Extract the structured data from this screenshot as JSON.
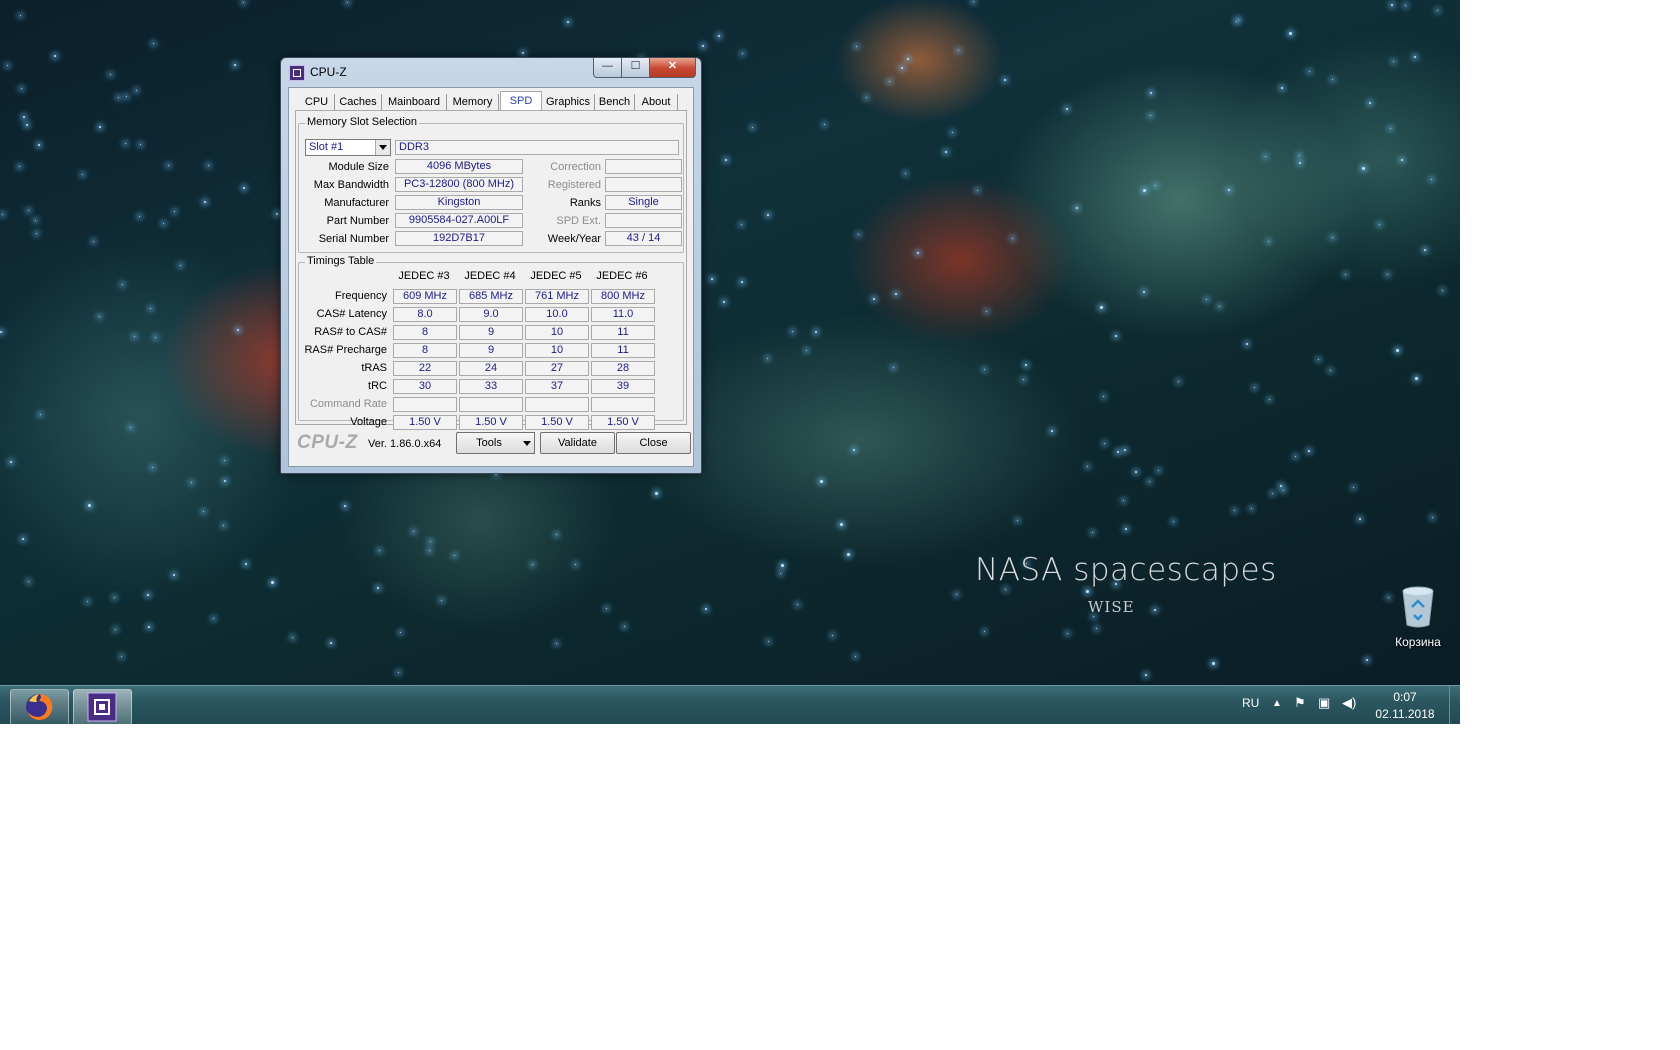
{
  "desktop": {
    "wallpaper_title": "NASA spacescapes",
    "wallpaper_subtitle": "WISE",
    "recycle_bin_label": "Корзина"
  },
  "taskbar": {
    "apps": [
      "firefox-icon",
      "cpu-z-icon"
    ],
    "language": "RU",
    "tray_icons": [
      "show-hidden-icons-arrow",
      "action-center-flag-icon",
      "network-icon",
      "volume-icon"
    ],
    "time": "0:07",
    "date": "02.11.2018"
  },
  "window": {
    "title": "CPU-Z",
    "controls": {
      "minimize": "—",
      "maximize": "☐",
      "close": "✕"
    },
    "tabs": [
      "CPU",
      "Caches",
      "Mainboard",
      "Memory",
      "SPD",
      "Graphics",
      "Bench",
      "About"
    ],
    "active_tab": "SPD"
  },
  "spd": {
    "slot_group_title": "Memory Slot Selection",
    "slot": "Slot #1",
    "memory_type": "DDR3",
    "labels": {
      "module_size": "Module Size",
      "max_bandwidth": "Max Bandwidth",
      "manufacturer": "Manufacturer",
      "part_number": "Part Number",
      "serial_number": "Serial Number",
      "correction": "Correction",
      "registered": "Registered",
      "ranks": "Ranks",
      "spd_ext": "SPD Ext.",
      "week_year": "Week/Year"
    },
    "values": {
      "module_size": "4096 MBytes",
      "max_bandwidth": "PC3-12800 (800 MHz)",
      "manufacturer": "Kingston",
      "part_number": "9905584-027.A00LF",
      "serial_number": "192D7B17",
      "correction": "",
      "registered": "",
      "ranks": "Single",
      "spd_ext": "",
      "week_year": "43 / 14"
    }
  },
  "timings": {
    "group_title": "Timings Table",
    "columns": [
      "JEDEC #3",
      "JEDEC #4",
      "JEDEC #5",
      "JEDEC #6"
    ],
    "rows": [
      {
        "label": "Frequency",
        "values": [
          "609 MHz",
          "685 MHz",
          "761 MHz",
          "800 MHz"
        ]
      },
      {
        "label": "CAS# Latency",
        "values": [
          "8.0",
          "9.0",
          "10.0",
          "11.0"
        ]
      },
      {
        "label": "RAS# to CAS#",
        "values": [
          "8",
          "9",
          "10",
          "11"
        ]
      },
      {
        "label": "RAS# Precharge",
        "values": [
          "8",
          "9",
          "10",
          "11"
        ]
      },
      {
        "label": "tRAS",
        "values": [
          "22",
          "24",
          "27",
          "28"
        ]
      },
      {
        "label": "tRC",
        "values": [
          "30",
          "33",
          "37",
          "39"
        ]
      },
      {
        "label": "Command Rate",
        "values": [
          "",
          "",
          "",
          ""
        ],
        "disabled": true
      },
      {
        "label": "Voltage",
        "values": [
          "1.50 V",
          "1.50 V",
          "1.50 V",
          "1.50 V"
        ]
      }
    ]
  },
  "footer": {
    "logo": "CPU-Z",
    "version": "Ver. 1.86.0.x64",
    "tools_label": "Tools",
    "validate_label": "Validate",
    "close_label": "Close"
  }
}
